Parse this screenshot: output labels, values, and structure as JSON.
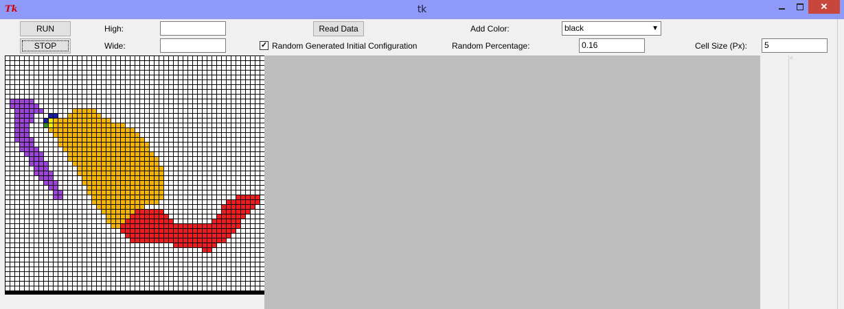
{
  "window": {
    "title": "tk",
    "logo": "Tk",
    "title_bar_color": "#8f99f7"
  },
  "window_controls": {
    "minimize_icon": "minimize-icon",
    "maximize_icon": "maximize-icon",
    "close_label": "✕"
  },
  "toolbar": {
    "run_label": "RUN",
    "stop_label": "STOP",
    "high_label": "High:",
    "high_value": "",
    "wide_label": "Wide:",
    "wide_value": "",
    "read_data_label": "Read Data",
    "random_checkbox_label": "Random Generated Initial Configuration",
    "random_checkbox_checked": true,
    "checkmark": "✓",
    "add_color_label": "Add Color:",
    "add_color_value": "black",
    "dropdown_arrow": "▼",
    "random_percentage_label": "Random Percentage:",
    "random_percentage_value": "0.16",
    "cell_size_label": "Cell Size (Px):",
    "cell_size_value": "5"
  },
  "scrollbar": {
    "up_arrow": "^"
  },
  "grid": {
    "columns": 54,
    "rows": 50,
    "background_color": "#000000",
    "cell_color": "#ffffff",
    "colors": {
      "purple": "#9d44d9",
      "orange": "#f5b40a",
      "red": "#ee1e1e",
      "blue": "#1a1aa8",
      "yellow": "#f0f000",
      "green": "#3a8a2a"
    },
    "regions": [
      {
        "color": "purple",
        "rows": [
          [
            9,
            1,
            5
          ],
          [
            10,
            1,
            6
          ],
          [
            11,
            2,
            7
          ],
          [
            12,
            2,
            5
          ],
          [
            13,
            2,
            5
          ],
          [
            14,
            2,
            4
          ],
          [
            15,
            2,
            4
          ],
          [
            16,
            2,
            4
          ],
          [
            17,
            2,
            5
          ],
          [
            18,
            3,
            5
          ],
          [
            19,
            3,
            6
          ],
          [
            20,
            4,
            7
          ],
          [
            21,
            5,
            7
          ],
          [
            22,
            5,
            8
          ],
          [
            23,
            6,
            8
          ],
          [
            24,
            6,
            9
          ],
          [
            25,
            7,
            9
          ],
          [
            26,
            8,
            10
          ],
          [
            27,
            9,
            10
          ],
          [
            28,
            10,
            11
          ],
          [
            29,
            10,
            11
          ]
        ]
      },
      {
        "color": "orange",
        "rows": [
          [
            11,
            14,
            18
          ],
          [
            12,
            13,
            19
          ],
          [
            13,
            10,
            21
          ],
          [
            14,
            9,
            24
          ],
          [
            15,
            9,
            26
          ],
          [
            16,
            10,
            27
          ],
          [
            17,
            11,
            28
          ],
          [
            18,
            11,
            29
          ],
          [
            19,
            12,
            29
          ],
          [
            20,
            13,
            30
          ],
          [
            21,
            13,
            31
          ],
          [
            22,
            14,
            31
          ],
          [
            23,
            15,
            32
          ],
          [
            24,
            15,
            32
          ],
          [
            25,
            16,
            32
          ],
          [
            26,
            16,
            32
          ],
          [
            27,
            17,
            32
          ],
          [
            28,
            17,
            32
          ],
          [
            29,
            18,
            32
          ],
          [
            30,
            18,
            31
          ],
          [
            31,
            19,
            28
          ],
          [
            32,
            20,
            26
          ],
          [
            33,
            21,
            25
          ],
          [
            34,
            21,
            25
          ],
          [
            35,
            22,
            24
          ]
        ]
      },
      {
        "color": "red",
        "rows": [
          [
            29,
            48,
            52
          ],
          [
            30,
            46,
            52
          ],
          [
            31,
            45,
            51
          ],
          [
            32,
            27,
            32
          ],
          [
            32,
            45,
            50
          ],
          [
            33,
            26,
            33
          ],
          [
            33,
            44,
            49
          ],
          [
            34,
            25,
            34
          ],
          [
            34,
            43,
            48
          ],
          [
            35,
            24,
            48
          ],
          [
            36,
            24,
            47
          ],
          [
            37,
            25,
            46
          ],
          [
            38,
            26,
            45
          ],
          [
            39,
            35,
            43
          ],
          [
            40,
            41,
            42
          ]
        ]
      },
      {
        "color": "blue",
        "rows": [
          [
            12,
            9,
            10
          ],
          [
            13,
            8,
            9
          ],
          [
            14,
            8,
            9
          ]
        ]
      },
      {
        "color": "yellow",
        "rows": [
          [
            13,
            9,
            9
          ],
          [
            14,
            9,
            9
          ]
        ]
      },
      {
        "color": "green",
        "rows": [
          [
            14,
            8,
            8
          ]
        ]
      }
    ]
  }
}
